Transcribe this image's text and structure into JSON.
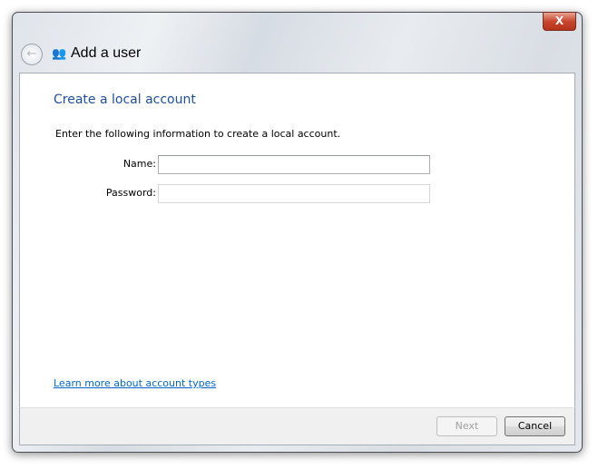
{
  "window": {
    "title": "Add a user",
    "close_label": "X"
  },
  "main": {
    "heading": "Create a local account",
    "intro": "Enter the following information to create a local account.",
    "fields": [
      {
        "label": "Name:",
        "value": ""
      },
      {
        "label": "Password:",
        "value": ""
      }
    ],
    "link": "Learn more about account types"
  },
  "footer": {
    "next_label": "Next",
    "cancel_label": "Cancel",
    "next_enabled": false
  }
}
